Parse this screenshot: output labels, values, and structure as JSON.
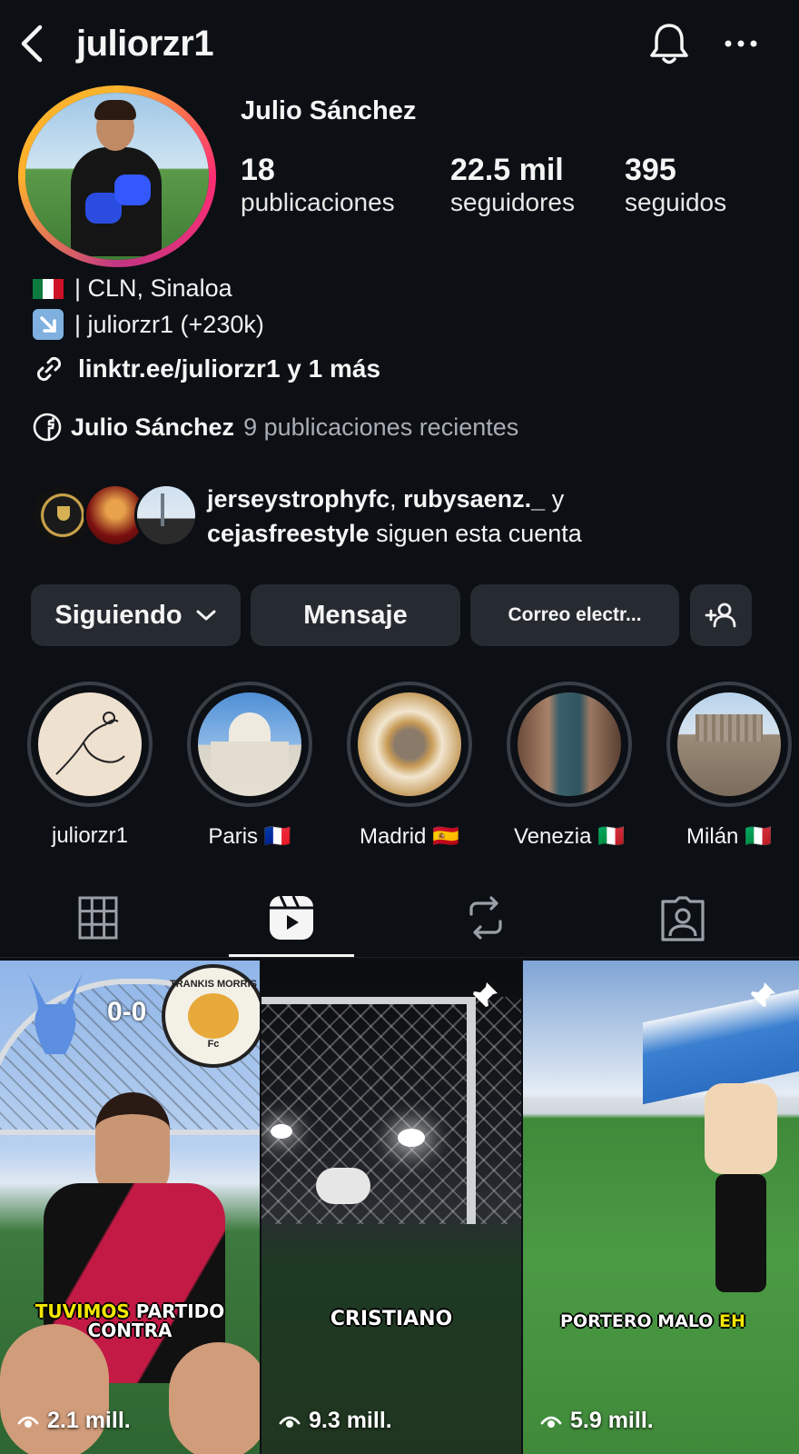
{
  "header": {
    "username": "juliorzr1"
  },
  "profile": {
    "full_name": "Julio Sánchez",
    "stats": [
      {
        "value": "18",
        "label": "publicaciones"
      },
      {
        "value": "22.5 mil",
        "label": "seguidores"
      },
      {
        "value": "395",
        "label": "seguidos"
      }
    ]
  },
  "bio": {
    "line1": "| CLN, Sinaloa",
    "line2": "| juliorzr1 (+230k)",
    "link": "linktr.ee/juliorzr1 y 1 más",
    "facebook_name": "Julio Sánchez",
    "facebook_meta": "9 publicaciones recientes"
  },
  "followed_by": {
    "user1": "jerseystrophyfc",
    "sep1": ", ",
    "user2": "rubysaenz._",
    "sep2": " y",
    "user3": "cejasfreestyle",
    "suffix": " siguen esta cuenta"
  },
  "actions": {
    "following": "Siguiendo",
    "message": "Mensaje",
    "email": "Correo electr..."
  },
  "highlights": [
    {
      "label": "juliorzr1"
    },
    {
      "label": "Paris 🇫🇷"
    },
    {
      "label": "Madrid 🇪🇸"
    },
    {
      "label": "Venezia 🇮🇹"
    },
    {
      "label": "Milán 🇮🇹"
    }
  ],
  "tabs": [
    "grid-icon",
    "reels-icon",
    "reposts-icon",
    "tagged-icon"
  ],
  "reels": [
    {
      "caption_highlight": "TUVIMOS",
      "caption_rest": " PARTIDO",
      "caption_line2": "CONTRA",
      "score": "0-0",
      "badge": "TRANKIS MORRIS",
      "badge_sub": "Fc",
      "views": "2.1 mill."
    },
    {
      "caption": "CRISTIANO",
      "views": "9.3 mill.",
      "pinned": true
    },
    {
      "caption": "PORTERO MALO ",
      "caption_highlight": "EH",
      "views": "5.9 mill.",
      "pinned": true
    }
  ],
  "colors": {
    "background": "#0c0f14",
    "button": "#262a31",
    "muted": "#a9adb5",
    "accent_yellow": "#f2e600"
  }
}
